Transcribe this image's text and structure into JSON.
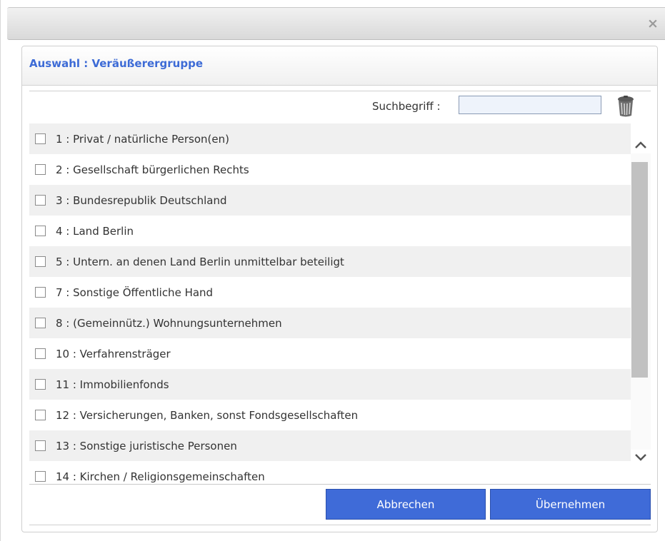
{
  "dialog": {
    "close_label": "×",
    "panel_title": "Auswahl : Veräußerergruppe",
    "search": {
      "label": "Suchbegriff :",
      "value": ""
    },
    "items": [
      {
        "label": "1 : Privat / natürliche Person(en)",
        "checked": false
      },
      {
        "label": "2 : Gesellschaft bürgerlichen Rechts",
        "checked": false
      },
      {
        "label": "3 : Bundesrepublik Deutschland",
        "checked": false
      },
      {
        "label": "4 : Land Berlin",
        "checked": false
      },
      {
        "label": "5 : Untern. an denen Land Berlin unmittelbar beteiligt",
        "checked": false
      },
      {
        "label": "7 : Sonstige Öffentliche Hand",
        "checked": false
      },
      {
        "label": "8 : (Gemeinnütz.) Wohnungsunternehmen",
        "checked": false
      },
      {
        "label": "10 : Verfahrensträger",
        "checked": false
      },
      {
        "label": "11 : Immobilienfonds",
        "checked": false
      },
      {
        "label": "12 : Versicherungen, Banken, sonst Fondsgesellschaften",
        "checked": false
      },
      {
        "label": "13 : Sonstige juristische Personen",
        "checked": false
      },
      {
        "label": "14 : Kirchen / Religionsgemeinschaften",
        "checked": false
      }
    ],
    "buttons": {
      "cancel": "Abbrechen",
      "apply": "Übernehmen"
    },
    "icons": {
      "close": "close-icon",
      "trash": "trash-icon",
      "scroll_up": "chevron-up-icon",
      "scroll_down": "chevron-down-icon"
    },
    "colors": {
      "accent": "#3f6bd8",
      "title": "#3d6bd6"
    }
  }
}
